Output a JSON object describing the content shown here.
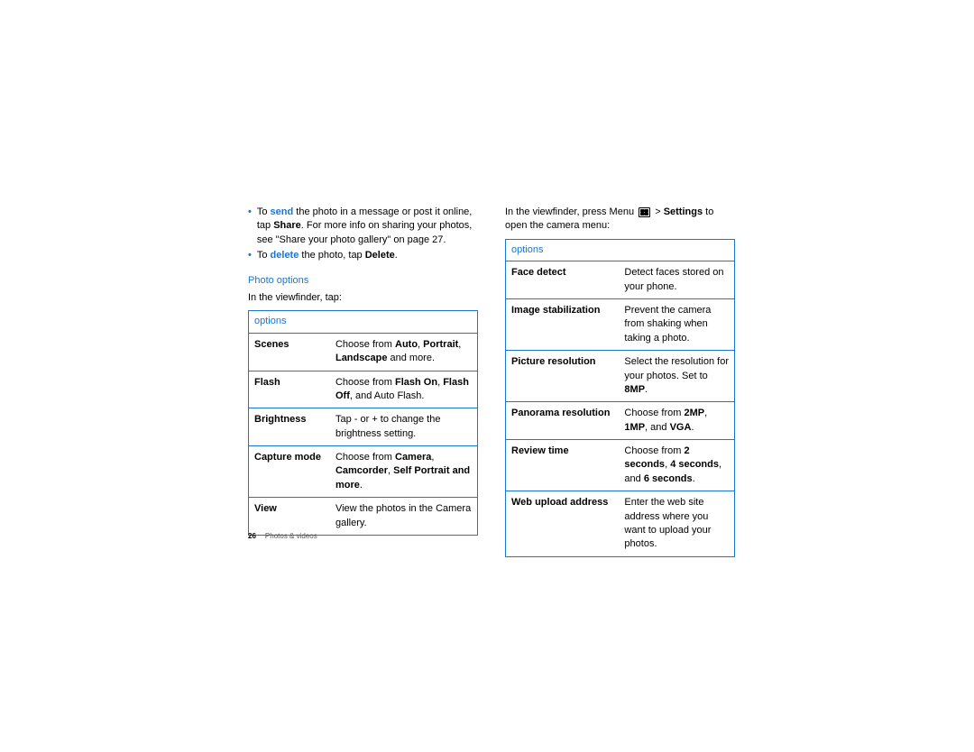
{
  "left": {
    "bullet1": {
      "pre": "To ",
      "action": "send",
      "post1": " the photo in a message or post it online, tap ",
      "bold": "Share",
      "post2": ". For more info on sharing your photos, see \"Share your photo gallery\" on page 27."
    },
    "bullet2": {
      "pre": "To ",
      "action": "delete",
      "post1": " the photo, tap ",
      "bold": "Delete",
      "post2": "."
    },
    "title": "Photo options",
    "intro": "In the viewfinder, tap:",
    "header": "options",
    "rows": {
      "r0": {
        "label": "Scenes",
        "p1": "Choose from ",
        "b1": "Auto",
        "s1": ", ",
        "b2": "Portrait",
        "s2": ", ",
        "b3": "Landscape",
        "s3": " and more."
      },
      "r1": {
        "label": "Flash",
        "p1": "Choose from ",
        "b1": "Flash On",
        "s1": ", ",
        "b2": "Flash Off",
        "s2": ", and Auto Flash."
      },
      "r2": {
        "label": "Brightness",
        "text": "Tap - or + to change the brightness setting."
      },
      "r3": {
        "label": "Capture mode",
        "p1": "Choose from ",
        "b1": "Camera",
        "s1": ", ",
        "b2": "Camcorder",
        "s2": ", ",
        "b3": "Self Portrait and more",
        "s3": "."
      },
      "r4": {
        "label": "View",
        "text": "View the photos in the Camera gallery."
      }
    }
  },
  "right": {
    "intro": {
      "p1": "In the viewfinder, press Menu ",
      "p2": " > ",
      "bold": "Settings",
      "p3": " to open the camera menu:"
    },
    "header": "options",
    "rows": {
      "r0": {
        "label": "Face detect",
        "text": "Detect faces stored on your phone."
      },
      "r1": {
        "label": "Image stabilization",
        "text": "Prevent the camera from shaking when taking a photo."
      },
      "r2": {
        "label": "Picture resolution",
        "p1": "Select the resolution for your photos. Set to ",
        "b1": "8MP",
        "s1": "."
      },
      "r3": {
        "label": "Panorama resolution",
        "p1": "Choose from ",
        "b1": "2MP",
        "s1": ", ",
        "b2": "1MP",
        "s2": ", and ",
        "b3": "VGA",
        "s3": "."
      },
      "r4": {
        "label": "Review time",
        "p1": "Choose from ",
        "b1": "2 seconds",
        "s1": ", ",
        "b2": "4 seconds",
        "s2": ", and ",
        "b3": "6 seconds",
        "s3": "."
      },
      "r5": {
        "label": "Web upload address",
        "text": "Enter the web site address where you want to upload your photos."
      }
    }
  },
  "footer": {
    "page": "26",
    "section": "Photos & videos"
  }
}
